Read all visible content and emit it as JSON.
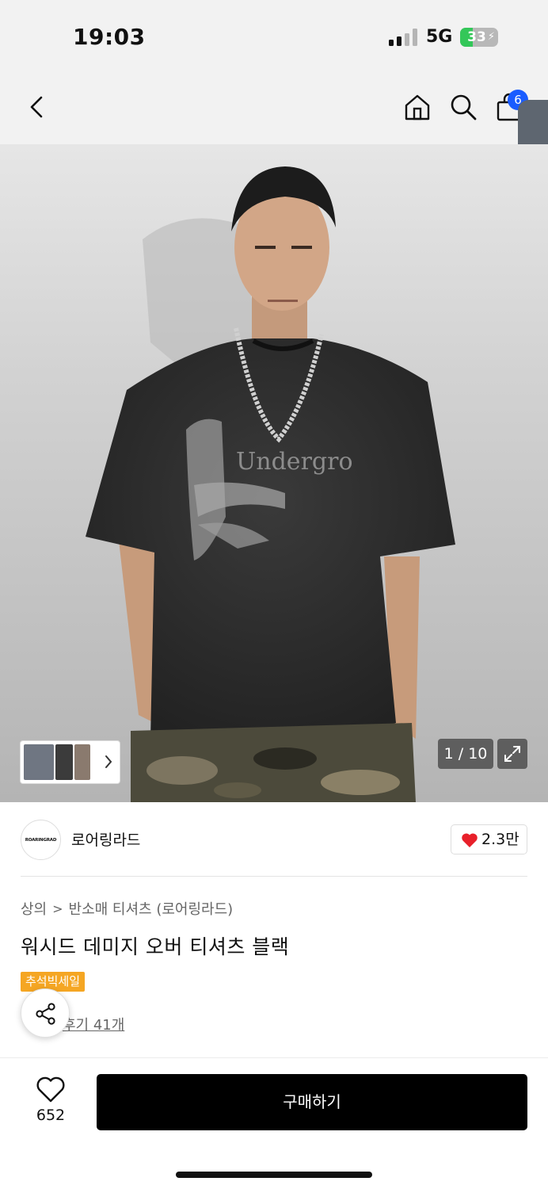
{
  "status_bar": {
    "time": "19:03",
    "network": "5G",
    "battery_level": "33",
    "battery_fraction": 0.33
  },
  "nav": {
    "cart_count": "6"
  },
  "gallery": {
    "counter": "1 / 10"
  },
  "brand": {
    "logo_text": "ROARINGRAD",
    "name": "로어링라드",
    "likes": "2.3만"
  },
  "product": {
    "breadcrumb": [
      "상의",
      "반소매 티셔츠 (로어링라드)"
    ],
    "breadcrumb_separator": ">",
    "title": "워시드 데미지 오버 티셔츠 블랙",
    "sale_badge": "추석빅세일",
    "review_link": "후기 41개"
  },
  "bottom_bar": {
    "wish_count": "652",
    "buy_label": "구매하기"
  },
  "colors": {
    "accent_blue": "#1a5cff",
    "sale_orange": "#f5a623",
    "heart_red": "#e8202a",
    "buy_black": "#000000"
  }
}
